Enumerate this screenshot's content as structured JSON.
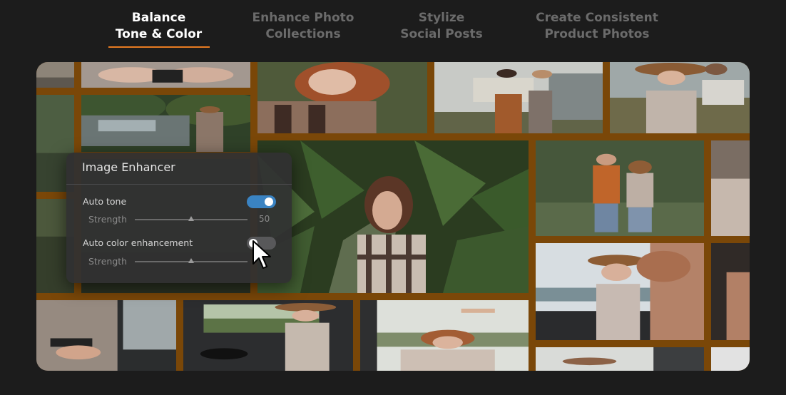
{
  "tabs": [
    {
      "line1": "Balance",
      "line2": "Tone & Color",
      "active": true
    },
    {
      "line1": "Enhance Photo",
      "line2": "Collections",
      "active": false
    },
    {
      "line1": "Stylize",
      "line2": "Social Posts",
      "active": false
    },
    {
      "line1": "Create Consistent",
      "line2": "Product Photos",
      "active": false
    }
  ],
  "accent_color": "#e87b22",
  "toggle_on_color": "#3a83c2",
  "panel": {
    "title": "Image Enhancer",
    "auto_tone": {
      "label": "Auto tone",
      "enabled": true,
      "strength_label": "Strength",
      "strength_value": "50",
      "strength": 0.5
    },
    "auto_color": {
      "label": "Auto color enhancement",
      "enabled": false,
      "strength_label": "Strength",
      "strength": 0.5
    }
  }
}
